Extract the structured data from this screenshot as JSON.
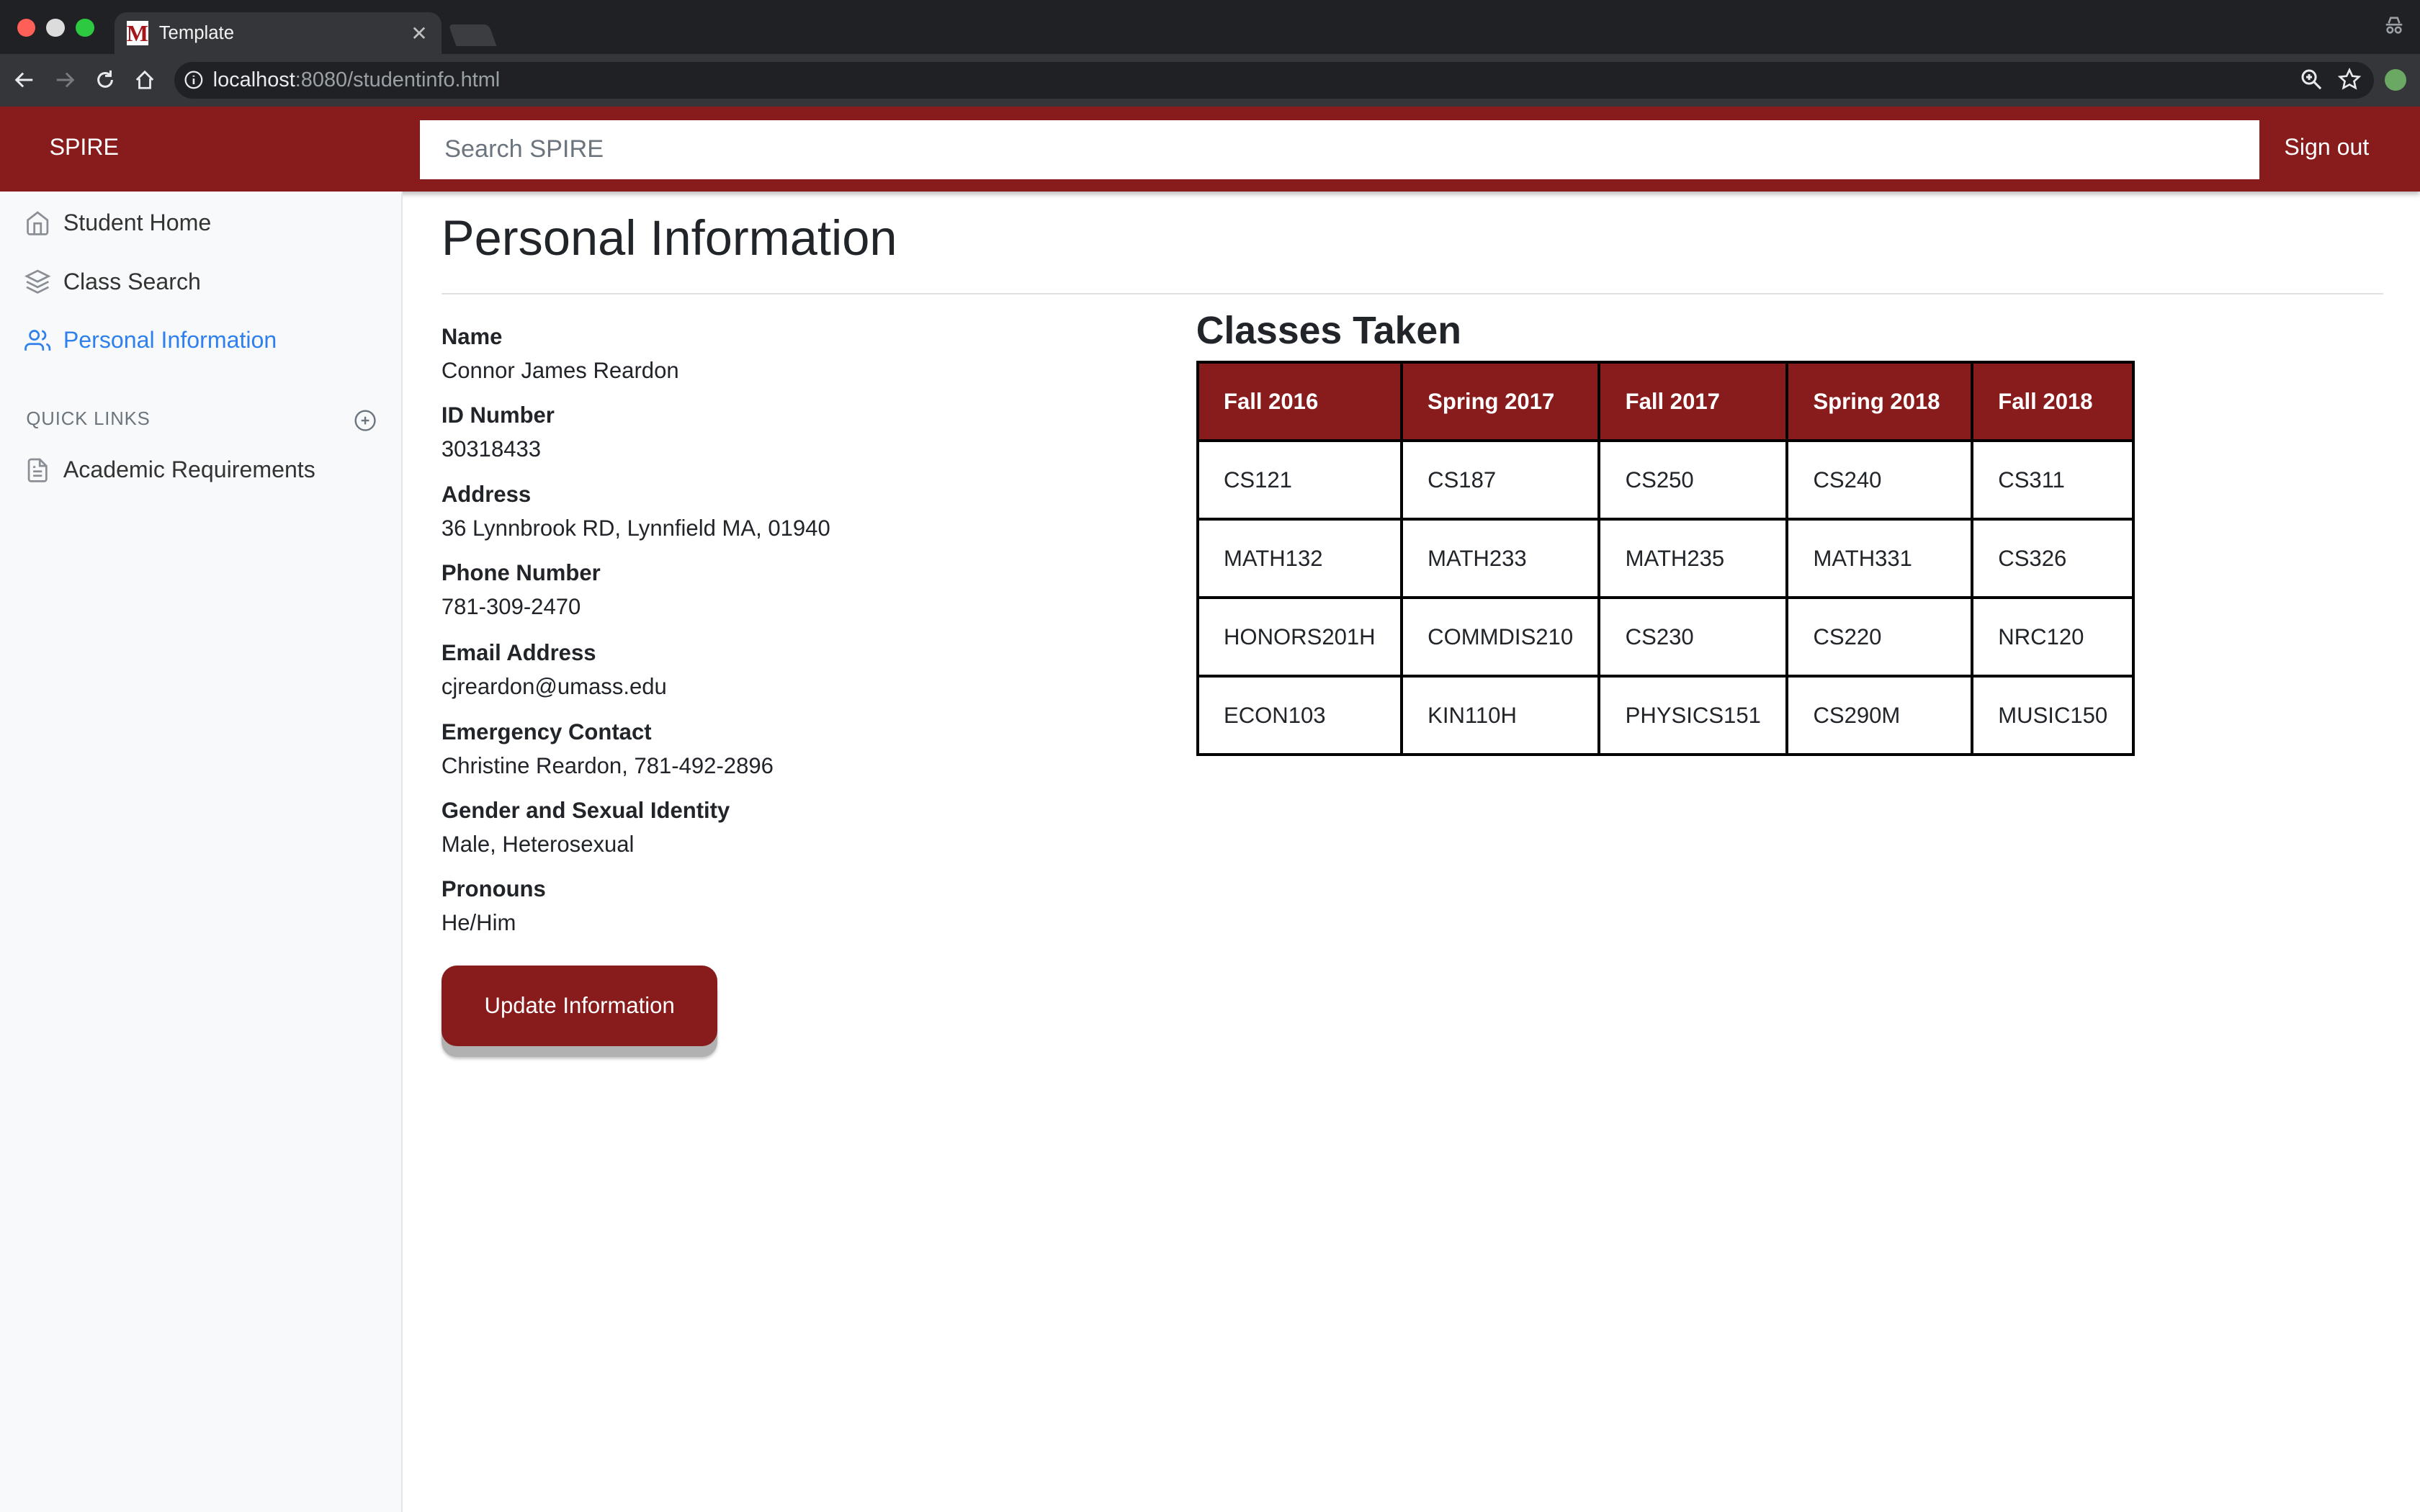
{
  "browser": {
    "tab_title": "Template",
    "favicon_letter": "M",
    "url_host": "localhost",
    "url_rest": ":8080/studentinfo.html"
  },
  "header": {
    "brand": "SPIRE",
    "search_placeholder": "Search SPIRE",
    "signout": "Sign out"
  },
  "sidebar": {
    "items": [
      {
        "label": "Student Home",
        "icon": "home-icon"
      },
      {
        "label": "Class Search",
        "icon": "layers-icon"
      },
      {
        "label": "Personal Information",
        "icon": "users-icon"
      }
    ],
    "quick_links_heading": "QUICK LINKS",
    "quick_links": [
      {
        "label": "Academic Requirements",
        "icon": "file-icon"
      }
    ]
  },
  "main": {
    "title": "Personal Information",
    "fields": [
      {
        "label": "Name",
        "value": "Connor James Reardon"
      },
      {
        "label": "ID Number",
        "value": "30318433"
      },
      {
        "label": "Address",
        "value": "36 Lynnbrook RD, Lynnfield MA, 01940"
      },
      {
        "label": "Phone Number",
        "value": "781-309-2470"
      },
      {
        "label": "Email Address",
        "value": "cjreardon@umass.edu"
      },
      {
        "label": "Emergency Contact",
        "value": "Christine Reardon, 781-492-2896"
      },
      {
        "label": "Gender and Sexual Identity",
        "value": "Male, Heterosexual"
      },
      {
        "label": "Pronouns",
        "value": "He/Him"
      }
    ],
    "update_button": "Update Information",
    "classes_title": "Classes Taken",
    "classes_headers": [
      "Fall 2016",
      "Spring 2017",
      "Fall 2017",
      "Spring 2018",
      "Fall 2018"
    ],
    "classes_rows": [
      [
        "CS121",
        "CS187",
        "CS250",
        "CS240",
        "CS311"
      ],
      [
        "MATH132",
        "MATH233",
        "MATH235",
        "MATH331",
        "CS326"
      ],
      [
        "HONORS201H",
        "COMMDIS210",
        "CS230",
        "CS220",
        "NRC120"
      ],
      [
        "ECON103",
        "KIN110H",
        "PHYSICS151",
        "CS290M",
        "MUSIC150"
      ]
    ]
  },
  "colors": {
    "brand": "#881c1c",
    "active_link": "#2f80ed"
  }
}
